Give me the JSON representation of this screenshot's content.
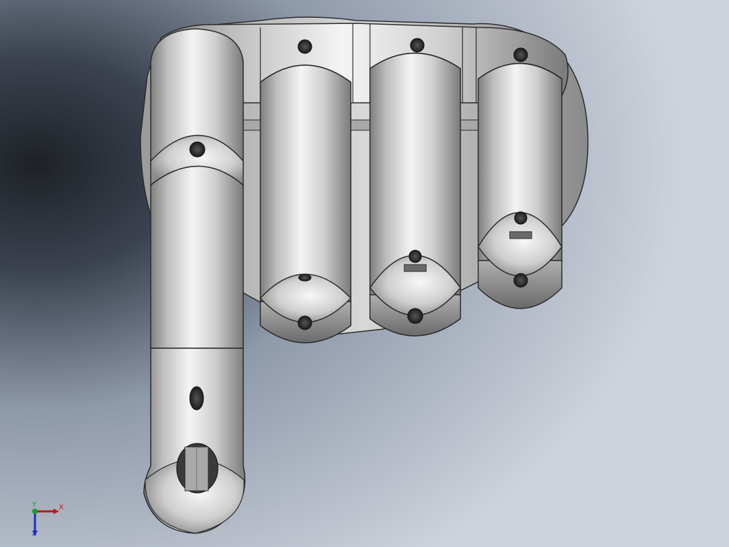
{
  "viewport": {
    "model": "robotic-hand",
    "view": "front",
    "background": {
      "top": "#8f9aaa",
      "bottom": "#cdd2da",
      "shadow": "#1e2227"
    }
  },
  "model": {
    "finger_count": 4,
    "thumb_visible": true,
    "colors": {
      "body": "#c8c8c8",
      "highlight": "#f2f2f2",
      "shade": "#8e8e8e",
      "edge": "#2a2a2a",
      "hole": "#3c3c3c"
    }
  },
  "triad": {
    "x_label": "X",
    "y_label": "Y",
    "z_label": "Z",
    "x_color": "#c0141c",
    "y_color": "#1a9b2a",
    "z_color": "#1b2bc4"
  }
}
